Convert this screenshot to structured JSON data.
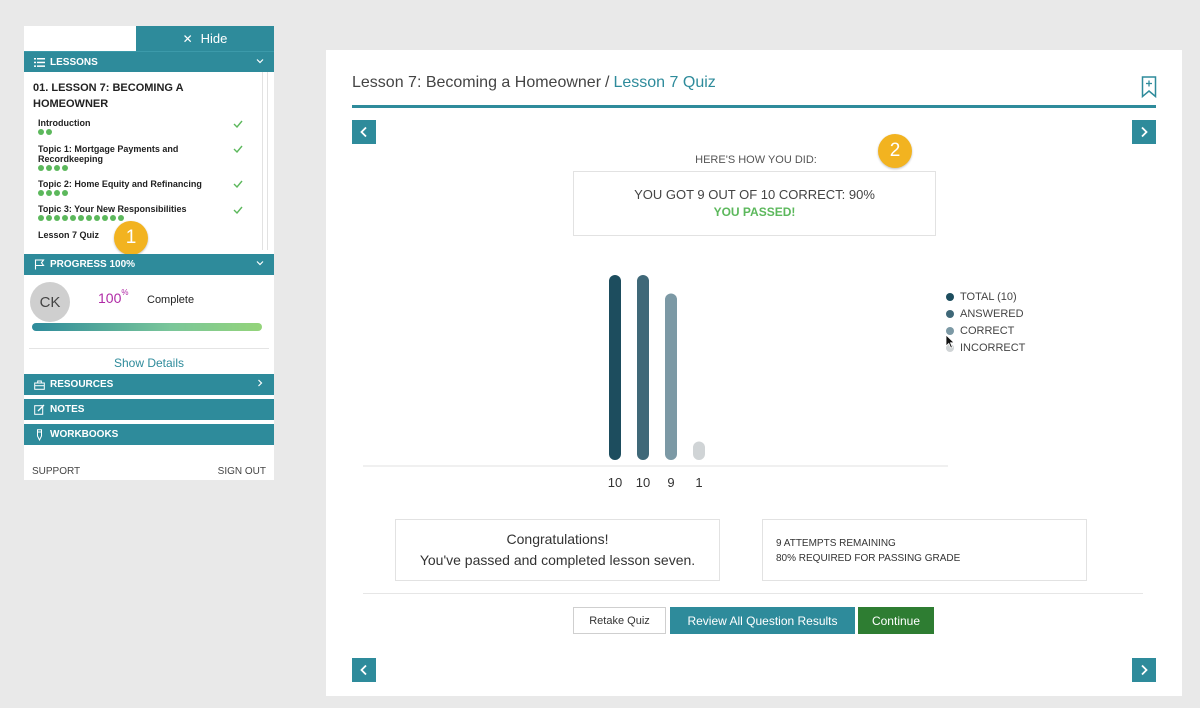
{
  "sidebar": {
    "hide_label": "Hide",
    "lessons_label": "LESSONS",
    "lesson_title": "01. LESSON 7: BECOMING A HOMEOWNER",
    "topics": [
      {
        "label": "Introduction",
        "dots": 2,
        "completed": true
      },
      {
        "label": "Topic 1: Mortgage Payments and Recordkeeping",
        "dots": 4,
        "completed": true
      },
      {
        "label": "Topic 2: Home Equity and Refinancing",
        "dots": 4,
        "completed": true
      },
      {
        "label": "Topic 3: Your New Responsibilities",
        "dots": 11,
        "completed": true
      },
      {
        "label": "Lesson 7 Quiz",
        "dots": 0,
        "completed": true
      }
    ],
    "callout_1": "1",
    "progress_label": "PROGRESS 100%",
    "avatar_initials": "CK",
    "progress_value": "100",
    "progress_unit": "%",
    "progress_fraction": 1.0,
    "complete_label": "Complete",
    "show_details": "Show Details",
    "resources_label": "RESOURCES",
    "notes_label": "NOTES",
    "workbooks_label": "WORKBOOKS",
    "support_label": "SUPPORT",
    "signout_label": "SIGN OUT"
  },
  "main": {
    "breadcrumb_lesson": "Lesson 7: Becoming a Homeowner",
    "breadcrumb_sep": "/",
    "breadcrumb_current": "Lesson 7 Quiz",
    "callout_2": "2",
    "heading": "HERE'S HOW YOU DID:",
    "result_text": "YOU GOT 9 OUT OF 10 CORRECT: 90%",
    "passed_text": "YOU PASSED!",
    "congrats_title": "Congratulations!",
    "congrats_msg": "You've passed and completed lesson seven.",
    "attempts_remaining": "9 ATTEMPTS REMAINING",
    "passing_grade": "80% REQUIRED FOR PASSING GRADE",
    "retake_label": "Retake Quiz",
    "review_label": "Review All Question Results",
    "continue_label": "Continue"
  },
  "colors": {
    "accent": "#2e8b9b",
    "success": "#5cb85c",
    "continue": "#2e7d32",
    "percent": "#b02aa6"
  },
  "chart_data": {
    "type": "bar",
    "categories": [
      "TOTAL (10)",
      "ANSWERED",
      "CORRECT",
      "INCORRECT"
    ],
    "values": [
      10,
      10,
      9,
      1
    ],
    "colors": [
      "#1d4d5e",
      "#3f6878",
      "#7c99a5",
      "#d0d4d6"
    ],
    "ylim": [
      0,
      10
    ],
    "legend": "right"
  }
}
